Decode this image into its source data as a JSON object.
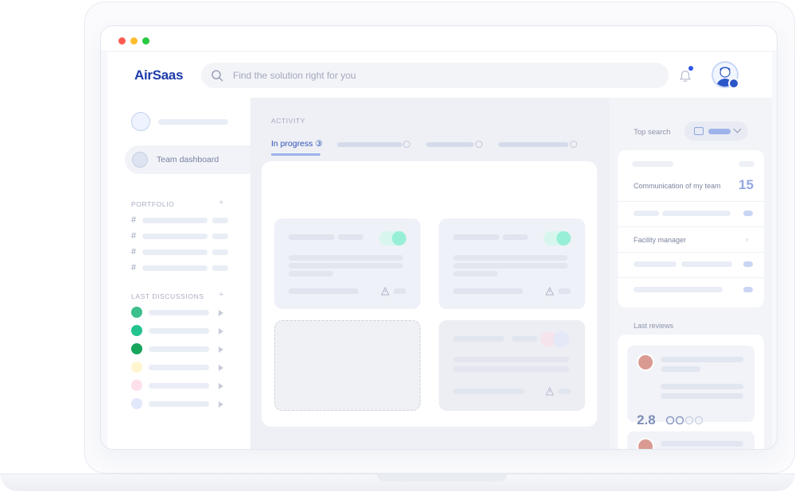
{
  "app": {
    "brand": "AirSaas",
    "search_placeholder": "Find the solution right for you"
  },
  "sidebar": {
    "team_dashboard": "Team dashboard",
    "portfolio_title": "PORTFOLIO",
    "last_discussions_title": "LAST DISCUSSIONS",
    "portfolio_items": [
      "#",
      "#",
      "#",
      "#"
    ],
    "discussion_colors": [
      "#3bbf8c",
      "#22c38e",
      "#17a45c",
      "#fff6cf",
      "#fde0ec",
      "#e2e8fb"
    ]
  },
  "main": {
    "section_label": "ACTIVITY",
    "active_tab": "In progress ③"
  },
  "right": {
    "top_search_label": "Top search",
    "rows": [
      {
        "label": "Communication of my team",
        "value": "15"
      },
      {
        "label": "Facility manager",
        "value": "›"
      }
    ],
    "last_reviews_label": "Last reviews",
    "review_rating": "2.8"
  },
  "colors": {
    "brand_blue": "#1d3aa8",
    "accent_blue": "#2f50b8",
    "toggle_green": "#98efd7",
    "notification_dot": "#2d56e8"
  }
}
